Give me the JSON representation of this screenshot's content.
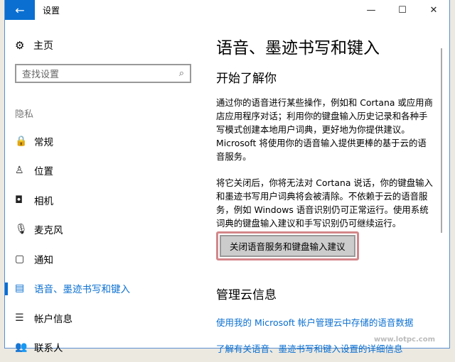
{
  "window": {
    "title": "设置",
    "back_icon": "←",
    "minimize": "—",
    "maximize": "☐",
    "close": "✕"
  },
  "sidebar": {
    "home": "主页",
    "search_placeholder": "查找设置",
    "section": "隐私",
    "items": [
      {
        "icon": "🔒",
        "label": "常规"
      },
      {
        "icon": "♙",
        "label": "位置"
      },
      {
        "icon": "◘",
        "label": "相机"
      },
      {
        "icon": "🎙",
        "label": "麦克风"
      },
      {
        "icon": "▢",
        "label": "通知"
      },
      {
        "icon": "▤",
        "label": "语音、墨迹书写和键入"
      },
      {
        "icon": "☰",
        "label": "帐户信息"
      },
      {
        "icon": "👥",
        "label": "联系人"
      }
    ]
  },
  "main": {
    "title": "语音、墨迹书写和键入",
    "section1": "开始了解你",
    "para1": "通过你的语音进行某些操作，例如和 Cortana 或应用商店应用程序对话；利用你的键盘输入历史记录和各种手写模式创建本地用户词典，更好地为你提供建议。Microsoft 将使用你的语音输入提供更棒的基于云的语音服务。",
    "para2": "将它关闭后，你将无法对 Cortana 说话，你的键盘输入和墨迹书写用户词典将会被清除。不依赖于云的语音服务，例如 Windows 语音识别仍可正常运行。使用系统词典的键盘输入建议和手写识别仍可继续运行。",
    "button": "关闭语音服务和键盘输入建议",
    "section2": "管理云信息",
    "link1": "使用我的 Microsoft 帐户管理云中存储的语音数据",
    "link2": "了解有关语音、墨迹书写和键入设置的详细信息"
  },
  "watermark": "www.lotpc.com"
}
